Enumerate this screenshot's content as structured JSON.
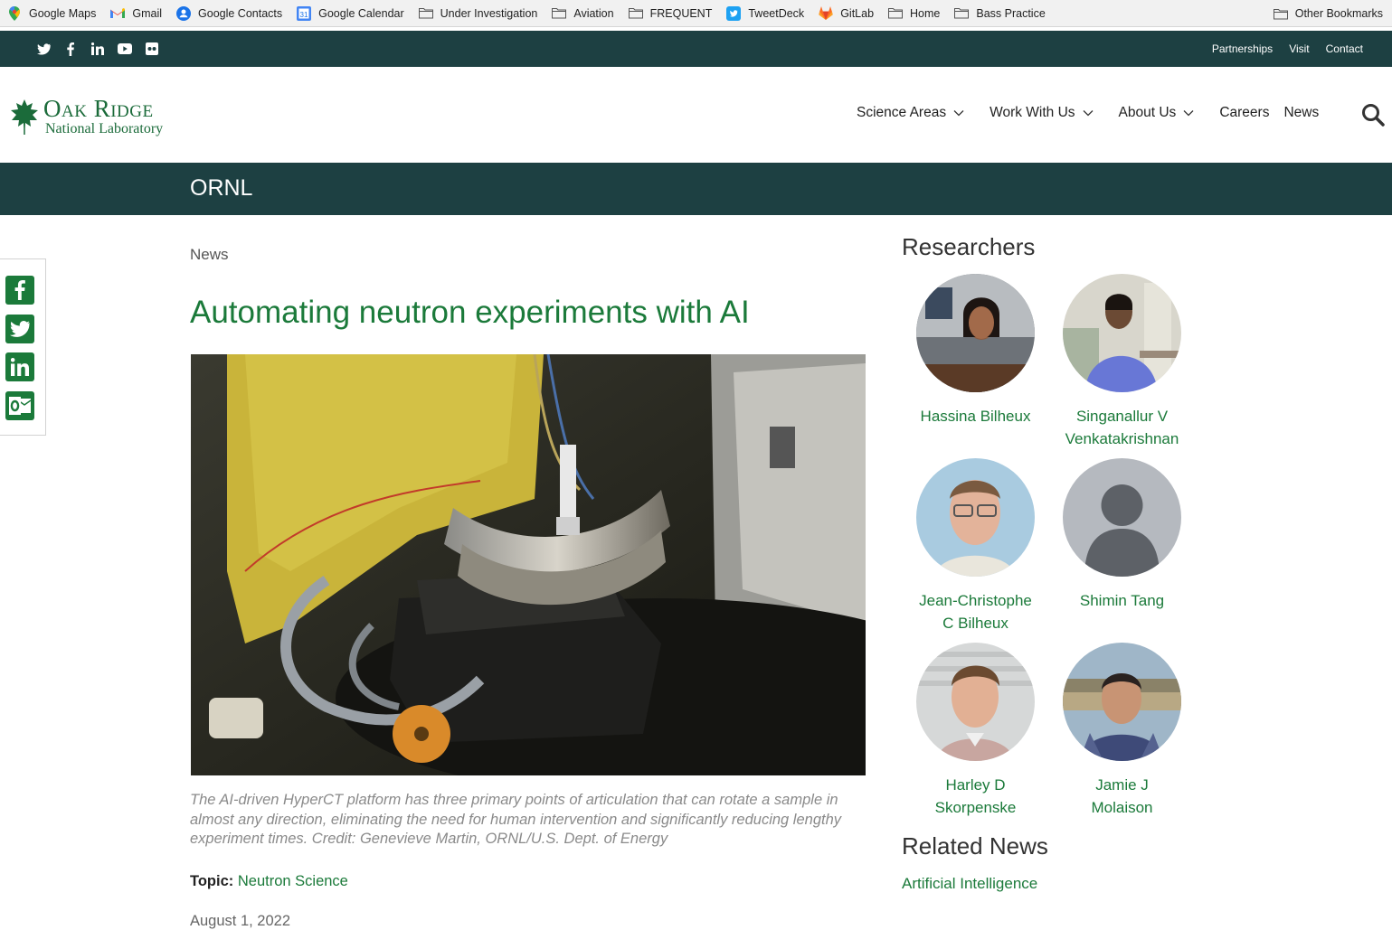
{
  "bookmarks": {
    "items": [
      {
        "label": "Google Maps",
        "icon": "google-maps-icon"
      },
      {
        "label": "Gmail",
        "icon": "gmail-icon"
      },
      {
        "label": "Google Contacts",
        "icon": "google-contacts-icon"
      },
      {
        "label": "Google Calendar",
        "icon": "google-calendar-icon"
      },
      {
        "label": "Under Investigation",
        "icon": "folder-icon"
      },
      {
        "label": "Aviation",
        "icon": "folder-icon"
      },
      {
        "label": "FREQUENT",
        "icon": "folder-icon"
      },
      {
        "label": "TweetDeck",
        "icon": "tweetdeck-icon"
      },
      {
        "label": "GitLab",
        "icon": "gitlab-icon"
      },
      {
        "label": "Home",
        "icon": "folder-icon"
      },
      {
        "label": "Bass Practice",
        "icon": "folder-icon"
      }
    ],
    "other": "Other Bookmarks"
  },
  "utility": {
    "social": [
      "twitter-icon",
      "facebook-icon",
      "linkedin-icon",
      "youtube-icon",
      "flickr-icon"
    ],
    "links": [
      "Partnerships",
      "Visit",
      "Contact"
    ]
  },
  "header": {
    "logo_line1": "Oak Ridge",
    "logo_line2": "National Laboratory",
    "nav": [
      {
        "label": "Science Areas",
        "has_dropdown": true
      },
      {
        "label": "Work With Us",
        "has_dropdown": true
      },
      {
        "label": "About Us",
        "has_dropdown": true
      },
      {
        "label": "Careers",
        "has_dropdown": false
      },
      {
        "label": "News",
        "has_dropdown": false
      }
    ]
  },
  "banner": {
    "title": "ORNL"
  },
  "share": [
    "facebook-icon",
    "twitter-icon",
    "linkedin-icon",
    "outlook-icon"
  ],
  "article": {
    "breadcrumb": "News",
    "title": "Automating neutron experiments with AI",
    "caption": "The AI-driven HyperCT platform has three primary points of articulation that can rotate a sample in almost any direction, eliminating the need for human intervention and significantly reducing lengthy experiment times. Credit: Genevieve Martin, ORNL/U.S. Dept. of Energy",
    "topic_label": "Topic:",
    "topic": "Neutron Science",
    "date": "August 1, 2022"
  },
  "sidebar": {
    "researchers_heading": "Researchers",
    "researchers": [
      {
        "name_line1": "Hassina Bilheux",
        "name_line2": ""
      },
      {
        "name_line1": "Singanallur V",
        "name_line2": "Venkatakrishnan"
      },
      {
        "name_line1": "Jean-Christophe",
        "name_line2": "C Bilheux"
      },
      {
        "name_line1": "Shimin Tang",
        "name_line2": ""
      },
      {
        "name_line1": "Harley D",
        "name_line2": "Skorpenske"
      },
      {
        "name_line1": "Jamie J",
        "name_line2": "Molaison"
      }
    ],
    "related_heading": "Related News",
    "related_links": [
      "Artificial Intelligence"
    ]
  },
  "colors": {
    "brand_green": "#1b7a3a",
    "dark_teal": "#1d4042"
  }
}
